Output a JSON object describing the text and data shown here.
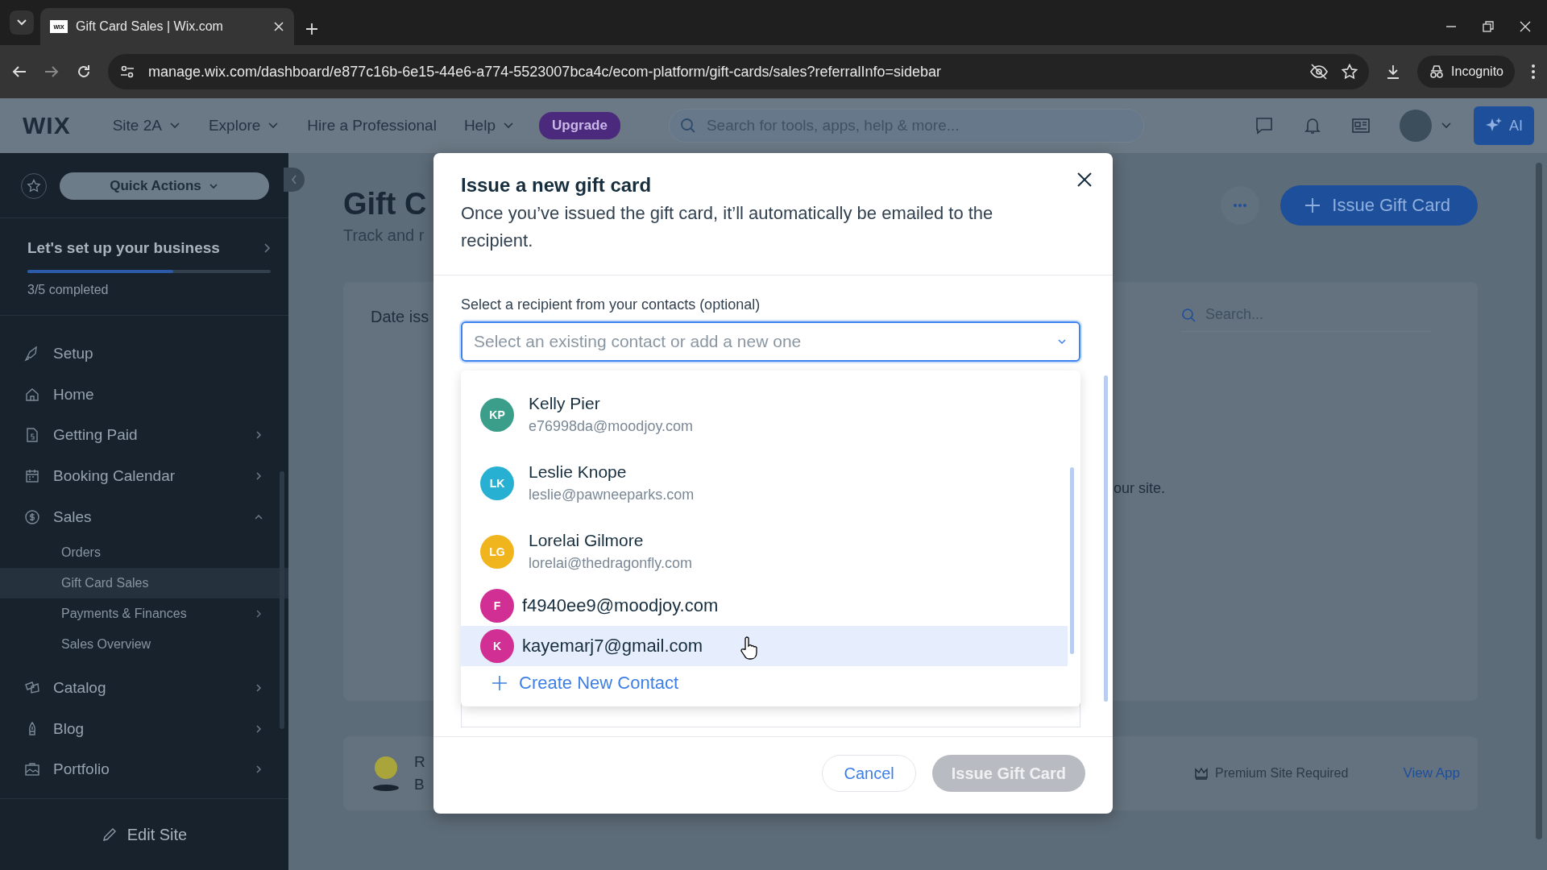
{
  "browser": {
    "tab_title": "Gift Card Sales | Wix.com",
    "favicon": "WIX",
    "url": "manage.wix.com/dashboard/e877c16b-6e15-44e6-a774-5523007bca4c/ecom-platform/gift-cards/sales?referralInfo=sidebar",
    "incognito": "Incognito"
  },
  "topbar": {
    "logo": "WIX",
    "site": "Site 2A",
    "nav": [
      {
        "label": "Explore",
        "dropdown": true
      },
      {
        "label": "Hire a Professional",
        "dropdown": false
      },
      {
        "label": "Help",
        "dropdown": true
      }
    ],
    "upgrade": "Upgrade",
    "search_placeholder": "Search for tools, apps, help & more...",
    "ai": "AI"
  },
  "sidebar": {
    "quick_actions": "Quick Actions",
    "setup": {
      "title": "Let's set up your business",
      "level": 0.6,
      "completed": "3/5 completed"
    },
    "items": [
      {
        "label": "Setup",
        "selected": false
      },
      {
        "label": "Home",
        "selected": false
      },
      {
        "label": "Getting Paid",
        "selected": false,
        "expanded": false
      },
      {
        "label": "Booking Calendar",
        "selected": false,
        "expanded": false
      },
      {
        "label": "Sales",
        "selected": false,
        "expanded": true,
        "children": [
          {
            "label": "Orders",
            "selected": false
          },
          {
            "label": "Gift Card Sales",
            "selected": true
          },
          {
            "label": "Payments & Finances",
            "selected": false,
            "expanded": false
          },
          {
            "label": "Sales Overview",
            "selected": false
          }
        ]
      },
      {
        "label": "Catalog",
        "selected": false,
        "expanded": false
      },
      {
        "label": "Blog",
        "selected": false,
        "expanded": false
      },
      {
        "label": "Portfolio",
        "selected": false,
        "expanded": false
      }
    ],
    "edit_site": "Edit Site"
  },
  "page": {
    "title": "Gift C",
    "subtitle": "Track and r",
    "issue_button": "Issue Gift Card",
    "column_1": "Date iss",
    "search_placeholder": "Search...",
    "empty_text": "our site.",
    "app_card": {
      "title": "R",
      "subtitle": "B",
      "premium": "Premium Site Required",
      "view_app": "View App"
    }
  },
  "modal": {
    "title": "Issue a new gift card",
    "description": "Once you’ve issued the gift card, it’ll automatically be emailed to the recipient.",
    "field_label": "Select a recipient from your contacts (optional)",
    "placeholder": "Select an existing contact or add a new one",
    "contacts": [
      {
        "kind": "named",
        "initials": "KP",
        "name": "Kelly Pier",
        "email": "e76998da@moodjoy.com",
        "color": "#3a9e8a",
        "selected": false
      },
      {
        "kind": "named",
        "initials": "LK",
        "name": "Leslie Knope",
        "email": "leslie@pawneeparks.com",
        "color": "#27b0d2",
        "selected": false
      },
      {
        "kind": "named",
        "initials": "LG",
        "name": "Lorelai Gilmore",
        "email": "lorelai@thedragonfly.com",
        "color": "#f0b41c",
        "selected": false
      },
      {
        "kind": "email_only",
        "initials": "F",
        "email": "f4940ee9@moodjoy.com",
        "color": "#d22f95",
        "selected": false
      },
      {
        "kind": "email_only",
        "initials": "K",
        "email": "kayemarj7@gmail.com",
        "color": "#d22f95",
        "selected": true
      }
    ],
    "create_contact": "Create New Contact",
    "cancel": "Cancel",
    "issue": {
      "label": "Issue Gift Card",
      "disabled": true
    }
  }
}
